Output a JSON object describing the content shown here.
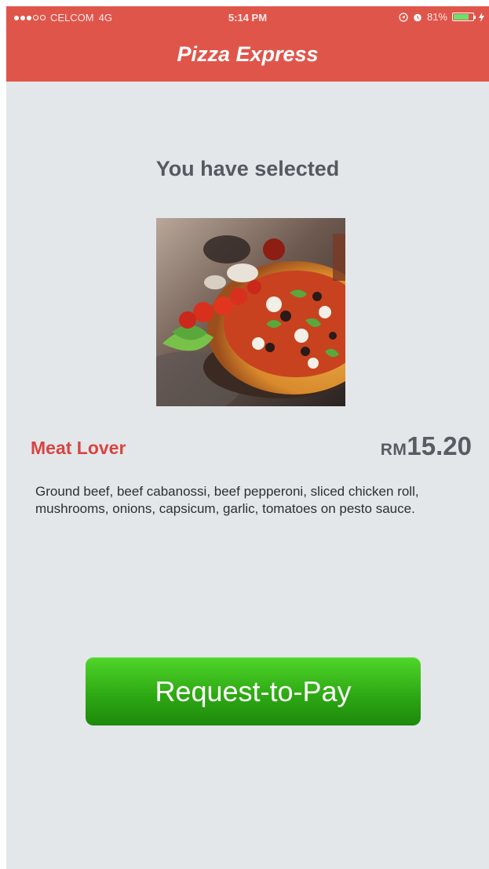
{
  "status_bar": {
    "carrier": "CELCOM",
    "network": "4G",
    "time": "5:14 PM",
    "battery_text": "81%",
    "battery_level": 0.81,
    "icons": [
      "signal-dots-icon",
      "location-icon",
      "alarm-icon",
      "battery-icon",
      "charging-icon"
    ]
  },
  "header": {
    "title": "Pizza Express",
    "background_color": "#e0554a"
  },
  "main": {
    "heading": "You have selected",
    "item": {
      "name": "Meat Lover",
      "currency": "RM",
      "price": "15.20",
      "description": "Ground beef, beef cabanossi, beef pepperoni, sliced chicken roll, mushrooms, onions, capsicum, garlic, tomatoes on pesto sauce.",
      "image_alt": "Pizza photo"
    },
    "pay_button": {
      "label": "Request-to-Pay",
      "color": "#2ea914"
    }
  }
}
